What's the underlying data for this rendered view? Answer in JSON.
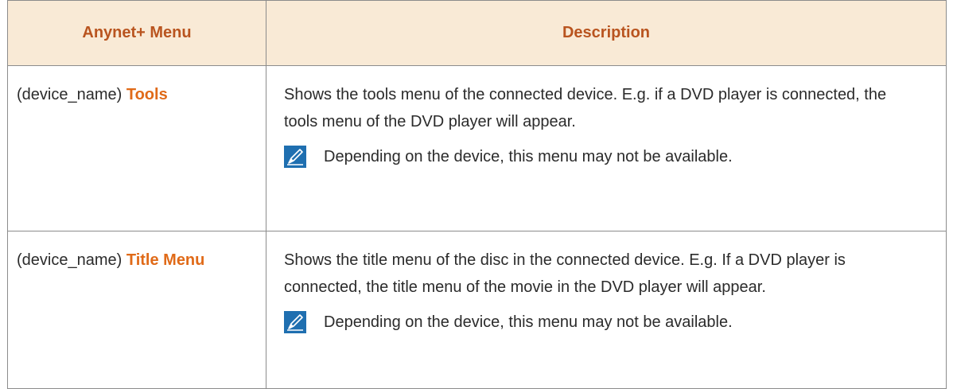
{
  "table": {
    "headers": {
      "menu": "Anynet+ Menu",
      "description": "Description"
    },
    "rows": [
      {
        "device_prefix": "(device_name) ",
        "menu_word": "Tools",
        "description": "Shows the tools menu of the connected device. E.g. if a DVD player is connected, the tools menu of the DVD player will appear.",
        "note": "Depending on the device, this menu may not be available."
      },
      {
        "device_prefix": "(device_name) ",
        "menu_word": "Title Menu",
        "description": "Shows the title menu of the disc in the connected device. E.g. If a DVD player is connected, the title menu of the movie in the DVD player will appear.",
        "note": "Depending on the device, this menu may not be available."
      }
    ]
  },
  "colors": {
    "header_bg": "#f9ead6",
    "header_text": "#b9541f",
    "menu_accent": "#e06a18",
    "note_icon_bg": "#1f6fb0"
  },
  "icons": {
    "note": "note-pencil-icon"
  }
}
